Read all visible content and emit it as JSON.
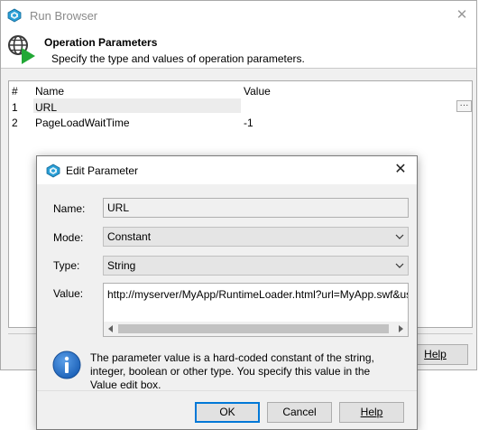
{
  "run_browser": {
    "title": "Run Browser",
    "close_glyph": "✕",
    "header_title": "Operation Parameters",
    "header_subtitle": "Specify the type and values of operation parameters.",
    "grid": {
      "columns": [
        "#",
        "Name",
        "Value"
      ],
      "rows": [
        {
          "num": "1",
          "name": "URL",
          "value": ""
        },
        {
          "num": "2",
          "name": "PageLoadWaitTime",
          "value": "-1"
        }
      ],
      "ellipsis_label": "···"
    },
    "help_label": "Help"
  },
  "edit_parameter": {
    "title": "Edit Parameter",
    "close_glyph": "✕",
    "name_label": "Name:",
    "name_value": "URL",
    "mode_label": "Mode:",
    "mode_value": "Constant",
    "type_label": "Type:",
    "type_value": "String",
    "value_label": "Value:",
    "value_text": "http://myserver/MyApp/RuntimeLoader.html?url=MyApp.swf&use",
    "info_text": "The parameter value is a hard-coded constant of the string, integer, boolean or other type. You specify this value in the Value edit box.",
    "ok_label": "OK",
    "cancel_label": "Cancel",
    "help_label": "Help"
  },
  "icons": {
    "app": "app-cube-icon",
    "header": "globe-play-icon",
    "info": "info-icon",
    "dropdown": "chevron-down-icon"
  },
  "colors": {
    "accent": "#0078d7",
    "info_blue": "#1e63b9",
    "play_green": "#22a836"
  }
}
